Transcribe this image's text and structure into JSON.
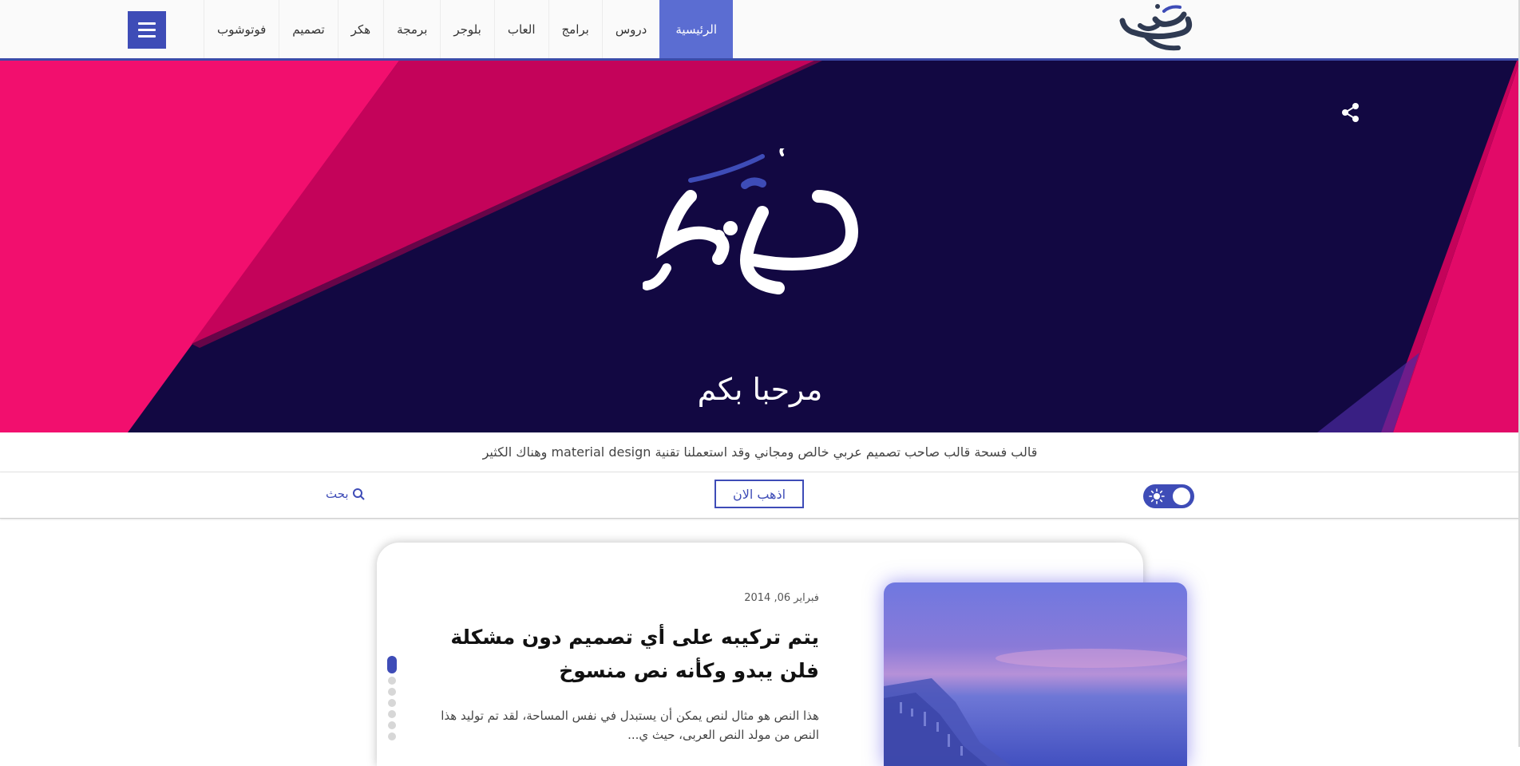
{
  "nav": {
    "items": [
      {
        "label": "الرئيسية",
        "active": true
      },
      {
        "label": "دروس"
      },
      {
        "label": "برامج"
      },
      {
        "label": "العاب"
      },
      {
        "label": "بلوجر"
      },
      {
        "label": "برمجة"
      },
      {
        "label": "هكر"
      },
      {
        "label": "تصميم"
      },
      {
        "label": "فوتوشوب"
      }
    ],
    "menu_icon": "hamburger-menu-icon"
  },
  "brand": {
    "logo_text": "فسحة"
  },
  "hero": {
    "title": "مرحبا بكم",
    "share_icon": "share-icon"
  },
  "description": "قالب فسحة قالب صاحب تصميم عربي خالص ومجاني وقد استعملنا تقنية material design وهناك الكثير",
  "actions": {
    "search_label": "بحث",
    "go_label": "اذهب الان",
    "theme_toggle_icon": "sun-icon"
  },
  "featured_post": {
    "date": "فبراير 06, 2014",
    "title": "يتم تركيبه على أي تصميم دون مشكلة فلن يبدو وكأنه نص منسوخ",
    "excerpt": "هذا النص هو مثال لنص يمكن أن يستبدل في نفس المساحة، لقد تم توليد هذا النص من مولد النص العربى، حيث ي...",
    "slider_dots": 7
  },
  "colors": {
    "accent": "#3e4cb7",
    "hero_navy": "#120842",
    "hero_pink": "#f20f6e",
    "hero_magenta": "#c4035a"
  }
}
